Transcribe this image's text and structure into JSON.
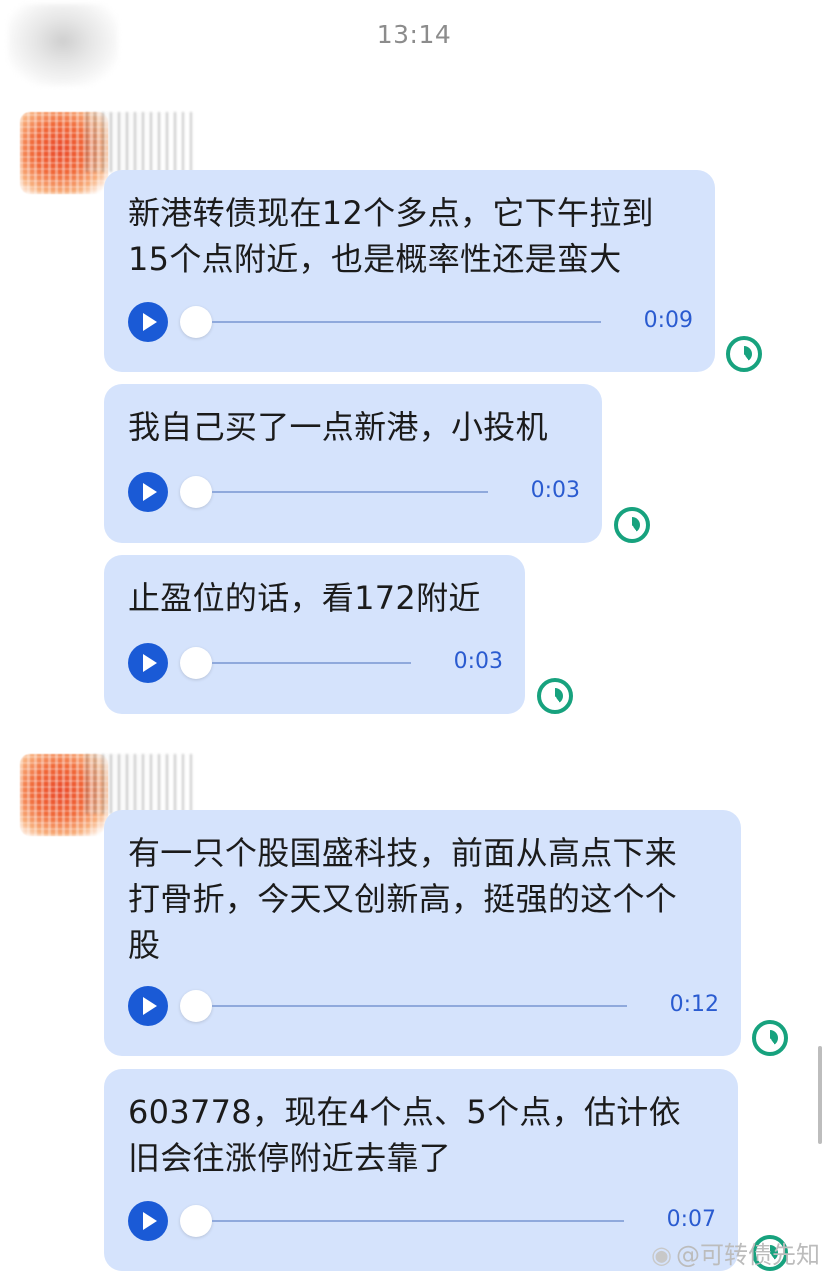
{
  "timestamp": "13:14",
  "messages": [
    {
      "text": "新港转债现在12个多点，它下午拉到\n15个点附近，也是概率性还是蛮大",
      "duration": "0:09"
    },
    {
      "text": "我自己买了一点新港，小投机",
      "duration": "0:03"
    },
    {
      "text": "止盈位的话，看172附近",
      "duration": "0:03"
    },
    {
      "text": "有一只个股国盛科技，前面从高点下来\n打骨折，今天又创新高，挺强的这个个\n股",
      "duration": "0:12"
    },
    {
      "text": "603778，现在4个点、5个点，估计依\n旧会往涨停附近去靠了",
      "duration": "0:07"
    }
  ],
  "watermark": "@可转债先知",
  "colors": {
    "bubble": "#d5e3fc",
    "play": "#1a5ad6",
    "status": "#17a27e",
    "duration": "#2a5bd0"
  }
}
